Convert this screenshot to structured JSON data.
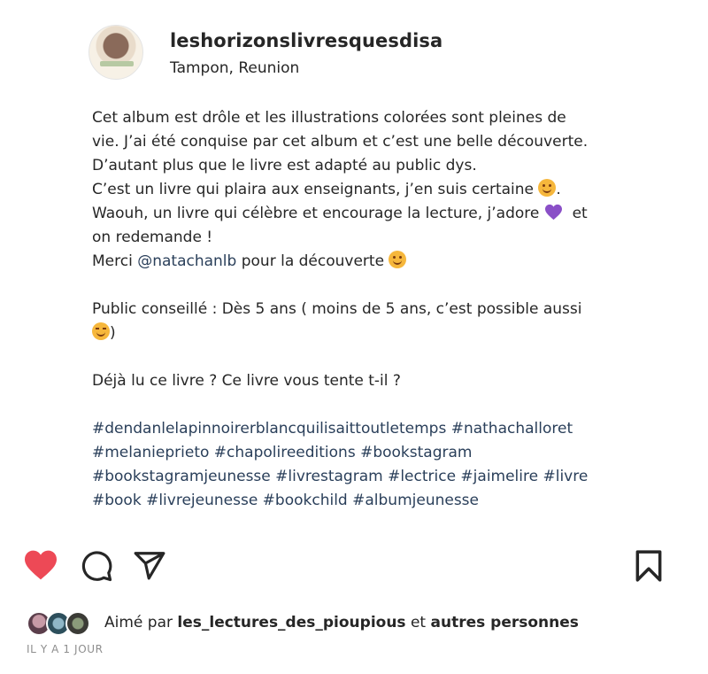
{
  "post": {
    "username": "leshorizonslivresquesdisa",
    "location": "Tampon, Reunion",
    "caption": {
      "l1": "Cet album est drôle et les illustrations colorées sont pleines de",
      "l2": "vie. J’ai été conquise par cet album et c’est une belle découverte.",
      "l3": "D’autant plus que le livre est adapté au public dys.",
      "l4": "C’est un livre qui plaira aux enseignants, j’en suis certaine",
      "l4_end": ".",
      "l5": "Waouh, un livre qui célèbre et encourage la lecture, j’adore",
      "l5_end": "et",
      "l6": "on redemande !",
      "l7_start": "Merci",
      "mention": "@natachanlb",
      "l7_end": "pour la découverte",
      "l8": "Public conseillé : Dès 5 ans ( moins de 5 ans, c’est possible aussi",
      "l9_end": ")",
      "l10": "Déjà lu ce livre ? Ce livre vous tente t-il ?",
      "h1": "#dendanlelapinnoirerblancquilisaittoutletemps #nathachalloret",
      "h2": "#melanieprieto #chapolireeditions #bookstagram",
      "h3": "#bookstagramjeunesse #livrestagram #lectrice #jaimelire #livre",
      "h4": "#book #livrejeunesse #bookchild #albumjeunesse"
    },
    "likes": {
      "prefix": "Aimé par",
      "user": "les_lectures_des_pioupious",
      "middle": "et",
      "others": "autres personnes"
    },
    "timestamp": "IL Y A 1 JOUR"
  },
  "icons": {
    "like": "heart-filled-icon",
    "comment": "comment-bubble-icon",
    "share": "paper-plane-icon",
    "save": "bookmark-icon"
  },
  "colors": {
    "like_red": "#ed4956",
    "mention_blue": "#2a3f5a",
    "timestamp_gray": "#8e8e8e",
    "text": "#262626"
  }
}
